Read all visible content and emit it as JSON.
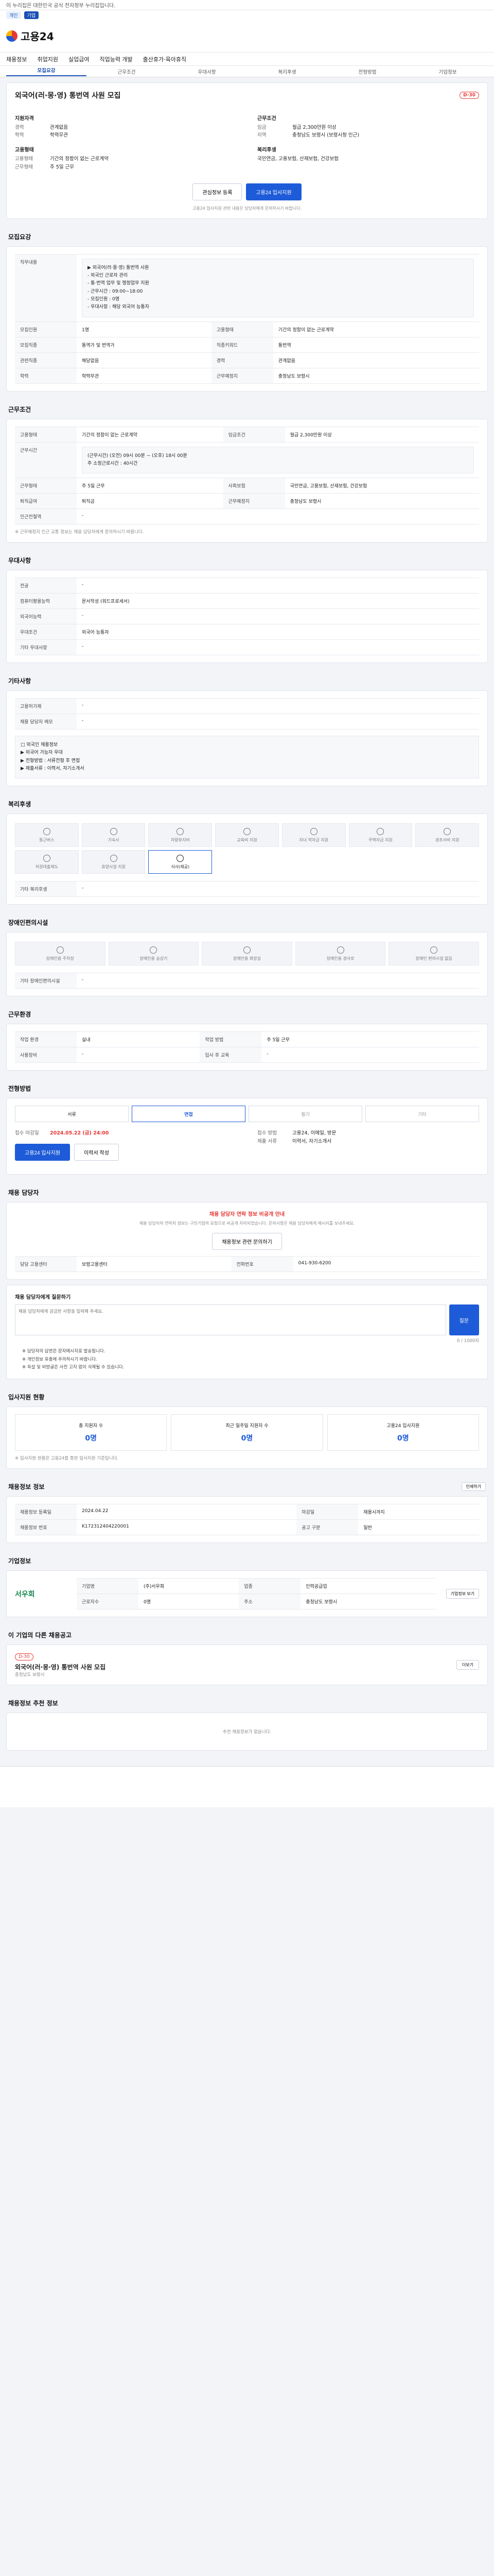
{
  "topbar": {
    "notice": "이 누리집은 대한민국 공식 전자정부 누리집입니다."
  },
  "utility": {
    "items": [
      "개인",
      "기업"
    ]
  },
  "header": {
    "logo_text": "고용24"
  },
  "gnb": [
    "채용정보",
    "취업지원",
    "실업급여",
    "직업능력 개발",
    "출산휴가·육아휴직"
  ],
  "subnav": [
    "모집요강",
    "근무조건",
    "우대사항",
    "복리후생",
    "전형방법",
    "기업정보"
  ],
  "job": {
    "title": "외국어(러·몽·영) 통번역 사원 모집",
    "dday": "D-30",
    "left_head": "지원자격",
    "left": [
      {
        "k": "경력",
        "v": "관계없음"
      },
      {
        "k": "학력",
        "v": "학력무관"
      }
    ],
    "right_head": "근무조건",
    "right": [
      {
        "k": "임금",
        "v": "월급 2,300만원 이상"
      },
      {
        "k": "지역",
        "v": "충청남도 보령시 (보령시청 인근)"
      }
    ],
    "left_head2": "고용형태",
    "left2": [
      {
        "k": "고용형태",
        "v": "기간의 정함이 없는 근로계약"
      },
      {
        "k": "근무형태",
        "v": "주 5일 근무"
      }
    ],
    "right_head2": "복리후생",
    "right2": [
      {
        "k": "",
        "v": "국민연금, 고용보험, 산재보험, 건강보험"
      }
    ],
    "btn_scrap": "관심정보 등록",
    "btn_apply": "고용24 입사지원",
    "apply_note": "고용24 입사지원 관련 내용은 담당자에게 문의하시기 바랍니다."
  },
  "recruit": {
    "title": "모집요강",
    "rows": [
      {
        "k": "직무내용",
        "v": "▶ 외국어(러·몽·영) 통번역 사원\n- 외국인 근로자 관리\n- 통·번역 업무 및 행정업무 지원\n- 근무시간 : 09:00~18:00\n- 모집인원 : 0명\n- 우대사항 : 해당 외국어 능통자"
      },
      {
        "k": "모집인원",
        "v": "1명"
      },
      {
        "k": "고용형태",
        "v": "기간의 정함이 없는 근로계약"
      },
      {
        "k": "모집직종",
        "v": "통역가 및 번역가"
      },
      {
        "k": "직종키워드",
        "v": "통번역"
      },
      {
        "k": "관련직종",
        "v": "해당없음"
      },
      {
        "k": "경력",
        "v": "관계없음"
      },
      {
        "k": "학력",
        "v": "학력무관"
      },
      {
        "k": "근무예정지",
        "v": "충청남도 보령시"
      }
    ]
  },
  "conditions": {
    "title": "근무조건",
    "rows": [
      {
        "k": "고용형태",
        "v": "기간의 정함이 없는 근로계약"
      },
      {
        "k": "임금조건",
        "v": "월급 2,300만원 이상"
      },
      {
        "k": "근무시간",
        "v": "(근무시간) (오전) 09시 00분 ~ (오후) 18시 00분\n주 소정근로시간 : 40시간"
      },
      {
        "k": "근무형태",
        "v": "주 5일 근무"
      },
      {
        "k": "사회보험",
        "v": "국민연금, 고용보험, 산재보험, 건강보험"
      },
      {
        "k": "퇴직급여",
        "v": "퇴직금"
      },
      {
        "k": "근무예정지",
        "v": "충청남도 보령시"
      },
      {
        "k": "인근전철역",
        "v": "-"
      }
    ],
    "footnote": "※ 근무예정지 인근 교통 정보는 채용 담당자에게 문의하시기 바랍니다."
  },
  "preference": {
    "title": "우대사항",
    "rows": [
      {
        "k": "전공",
        "v": "-"
      },
      {
        "k": "컴퓨터활용능력",
        "v": "문서작성 (워드프로세서)"
      },
      {
        "k": "외국어능력",
        "v": "-"
      },
      {
        "k": "우대조건",
        "v": "외국어 능통자"
      },
      {
        "k": "기타 우대사항",
        "v": "-"
      }
    ]
  },
  "etc": {
    "title": "기타사항",
    "rows": [
      {
        "k": "고용허가제",
        "v": "-"
      },
      {
        "k": "채용 담당자 메모",
        "v": "-"
      }
    ],
    "box": "□ 외국인 채용정보\n▶ 외국어 가능자 우대\n▶ 전형방법 : 서류전형 후 면접\n▶ 제출서류 : 이력서, 자기소개서"
  },
  "welfare": {
    "title": "복리후생",
    "items": [
      "통근버스",
      "기숙사",
      "차량유지비",
      "교육비 지원",
      "자녀 학자금 지원",
      "주택자금 지원",
      "경조사비 지원",
      "직원대출제도",
      "휴양시설 지원",
      "식사(제공)"
    ],
    "active": [
      9
    ],
    "other_label": "기타 복리후생",
    "other_value": "-"
  },
  "disability": {
    "title": "장애인편의시설",
    "items": [
      "장애인용 주차장",
      "장애인용 승강기",
      "장애인용 화장실",
      "장애인용 경사로",
      "장애인 편의시설 없음"
    ],
    "other_label": "기타 장애인편의시설",
    "other_value": "-"
  },
  "working": {
    "title": "근무환경",
    "rows": [
      {
        "k": "작업 환경",
        "v": "실내"
      },
      {
        "k": "작업 방법",
        "v": "주 5일 근무"
      },
      {
        "k": "사용장비",
        "v": "-"
      },
      {
        "k": "입사 후 교육",
        "v": "-"
      }
    ]
  },
  "selection": {
    "title": "전형방법",
    "steps": [
      "서류",
      "면접",
      "필기",
      "기타"
    ],
    "active_steps": [
      0,
      1
    ],
    "period_label": "접수 마감일",
    "period_value": "2024.05.22 (금) 24:00",
    "method_label": "접수 방법",
    "method_value": "고용24, 이메일, 방문",
    "doc_label": "제출 서류",
    "doc_value": "이력서, 자기소개서",
    "btn_apply": "고용24 입사지원",
    "btn_print": "이력서 작성"
  },
  "manager": {
    "title": "채용 담당자",
    "alert": "채용 담당자 연락 정보 비공개 안내",
    "alert_body": "채용 담당자의 연락처 정보는 구인기업의 요청으로 비공개 처리되었습니다. 문의사항은 채용 담당자에게 메시지를 보내주세요.",
    "btn_view": "채용정보 관련 문의하기",
    "office_label": "담당 고용센터",
    "office_value": "보령고용센터",
    "phone_label": "전화번호",
    "phone_value": "041-930-6200"
  },
  "inquiry": {
    "title": "채용 담당자에게 질문하기",
    "placeholder": "채용 담당자에게 궁금한 사항을 입력해 주세요.",
    "btn_send": "질문",
    "count": "0 / 1000자",
    "notes": [
      "※ 담당자의 답변은 문자메시지로 발송됩니다.",
      "※ 개인정보 유출에 주의하시기 바랍니다.",
      "※ 욕설 및 비방글은 사전 고지 없이 삭제될 수 있습니다."
    ]
  },
  "stats": {
    "title": "입사지원 현황",
    "items": [
      {
        "label": "총 지원자 수",
        "value": "0명"
      },
      {
        "label": "최근 일주일 지원자 수",
        "value": "0명"
      },
      {
        "label": "고용24 입사지원",
        "value": "0명"
      }
    ],
    "note": "※ 입사지원 현황은 고용24를 통한 입사지원 기준입니다."
  },
  "info": {
    "title": "채용정보 정보",
    "btn_print": "인쇄하기",
    "rows": [
      {
        "k": "채용정보 등록일",
        "v": "2024.04.22"
      },
      {
        "k": "마감일",
        "v": "채용시까지"
      },
      {
        "k": "채용정보 번호",
        "v": "K172312404220001"
      },
      {
        "k": "공고 구분",
        "v": "일반"
      }
    ]
  },
  "company": {
    "title": "기업정보",
    "logo": "서우회",
    "rows": [
      {
        "k": "기업명",
        "v": "(주)서우회"
      },
      {
        "k": "업종",
        "v": "인력공급업"
      },
      {
        "k": "근로자수",
        "v": "0명"
      },
      {
        "k": "주소",
        "v": "충청남도 보령시"
      }
    ],
    "btn": "기업정보 보기"
  },
  "related": {
    "title": "이 기업의 다른 채용공고",
    "item_date": "D-30",
    "item_title": "외국어(러·몽·영) 통번역 사원 모집",
    "item_meta": "충청남도 보령시",
    "btn_more": "더보기"
  },
  "recommend": {
    "title": "채용정보 추천 정보",
    "empty": "추천 채용정보가 없습니다."
  }
}
